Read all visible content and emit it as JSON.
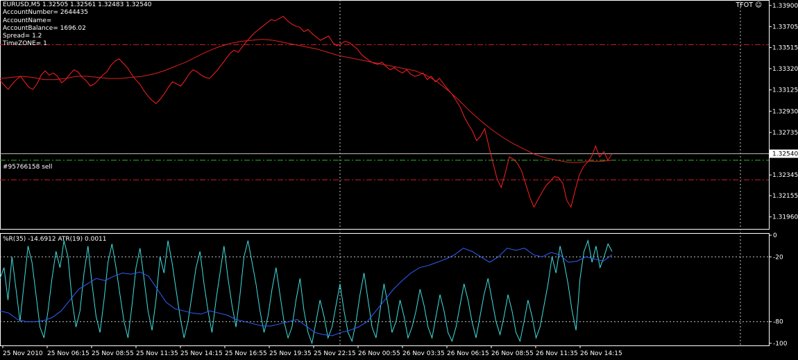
{
  "header": {
    "symbol_line": "EURUSD,M5  1.32505 1.32561 1.32483 1.32540",
    "account_number": "AccountNumber= 2644435",
    "account_name": "AccountName=",
    "account_balance": "AccountBalance= 1696.02",
    "spread": "Spread= 1.2",
    "timezone": "TimeZONE= 1",
    "expert_badge": "TFOT ☺"
  },
  "indicator_label": "%R(35) -14.6912  ATR(19) 0.0011",
  "order_label": "#95766158 sell",
  "colors": {
    "background": "#000000",
    "price_line": "#ff2020",
    "ma_line": "#e02020",
    "wpr_line": "#40e0e0",
    "atr_line": "#3060ff",
    "grid": "#c8c8c8",
    "order_line": "#c0c0c0",
    "stop_line": "#d02020",
    "tp_line": "#20c020"
  },
  "chart_data": [
    {
      "type": "line",
      "panel": "price",
      "ylim": [
        1.3185,
        1.3395
      ],
      "yticks": [
        "1.33900",
        "1.33705",
        "1.33515",
        "1.33320",
        "1.33125",
        "1.32930",
        "1.32735",
        "1.32540",
        "1.32345",
        "1.32155",
        "1.31960"
      ],
      "current_price": "1.32540",
      "order_level": 1.3254,
      "tp_level": 1.3248,
      "stop_levels": [
        1.3354,
        1.323
      ],
      "series": [
        {
          "role": "price",
          "values": [
            1.3321,
            1.3317,
            1.3313,
            1.3318,
            1.3322,
            1.3325,
            1.332,
            1.3315,
            1.3313,
            1.3318,
            1.3326,
            1.333,
            1.3326,
            1.3328,
            1.3325,
            1.3319,
            1.3322,
            1.3327,
            1.3331,
            1.3329,
            1.3324,
            1.3321,
            1.3316,
            1.3318,
            1.3322,
            1.3326,
            1.3329,
            1.3335,
            1.3339,
            1.3341,
            1.3337,
            1.3333,
            1.3327,
            1.3322,
            1.3318,
            1.3312,
            1.3307,
            1.3303,
            1.33,
            1.3304,
            1.3309,
            1.3315,
            1.332,
            1.3318,
            1.3316,
            1.3321,
            1.3327,
            1.3331,
            1.3329,
            1.3326,
            1.3324,
            1.3323,
            1.3327,
            1.3331,
            1.3336,
            1.3341,
            1.3346,
            1.3349,
            1.3347,
            1.3352,
            1.3357,
            1.3361,
            1.3365,
            1.3368,
            1.3371,
            1.3374,
            1.3377,
            1.3376,
            1.3378,
            1.338,
            1.3376,
            1.3373,
            1.3371,
            1.337,
            1.3366,
            1.3368,
            1.3364,
            1.3361,
            1.3358,
            1.336,
            1.3362,
            1.3356,
            1.3353,
            1.3355,
            1.3357,
            1.3356,
            1.3353,
            1.335,
            1.3345,
            1.3342,
            1.3339,
            1.3337,
            1.3336,
            1.3338,
            1.3334,
            1.3331,
            1.3333,
            1.333,
            1.3328,
            1.3331,
            1.3327,
            1.3325,
            1.3326,
            1.3328,
            1.3322,
            1.3325,
            1.332,
            1.3323,
            1.3318,
            1.3313,
            1.3309,
            1.3303,
            1.3297,
            1.3288,
            1.3281,
            1.3275,
            1.3266,
            1.327,
            1.3277,
            1.3261,
            1.3246,
            1.3231,
            1.3223,
            1.3236,
            1.3251,
            1.3249,
            1.3245,
            1.3238,
            1.3226,
            1.3214,
            1.3205,
            1.3212,
            1.3219,
            1.3225,
            1.3229,
            1.3233,
            1.3232,
            1.3227,
            1.3211,
            1.3205,
            1.322,
            1.3234,
            1.3242,
            1.3246,
            1.3251,
            1.3261,
            1.3251,
            1.3256,
            1.3248,
            1.3254
          ]
        },
        {
          "role": "moving-average",
          "values": [
            1.3323,
            1.3324,
            1.3325,
            1.3324,
            1.3322,
            1.3322,
            1.3323,
            1.3325,
            1.3325,
            1.3324,
            1.3323,
            1.3323,
            1.3324,
            1.3325,
            1.3327,
            1.333,
            1.3334,
            1.3338,
            1.3343,
            1.3348,
            1.3352,
            1.3355,
            1.3357,
            1.3358,
            1.3359,
            1.3358,
            1.3356,
            1.3354,
            1.3352,
            1.335,
            1.3347,
            1.3344,
            1.3342,
            1.334,
            1.3338,
            1.3336,
            1.3334,
            1.3332,
            1.333,
            1.3326,
            1.332,
            1.3312,
            1.3303,
            1.3293,
            1.3284,
            1.3276,
            1.3269,
            1.3263,
            1.3258,
            1.3253,
            1.325,
            1.3248,
            1.3246,
            1.3246,
            1.3247,
            1.3247,
            1.3248
          ]
        }
      ]
    },
    {
      "type": "line",
      "panel": "indicator",
      "ylim": [
        -102,
        2
      ],
      "yticks": [
        "0",
        "-20",
        "-80",
        "-100"
      ],
      "levels": [
        -20,
        -80
      ],
      "series": [
        {
          "role": "wpr",
          "values": [
            -40,
            -30,
            -60,
            -20,
            -50,
            -80,
            -45,
            -10,
            -25,
            -55,
            -85,
            -95,
            -70,
            -40,
            -15,
            -30,
            -5,
            -20,
            -60,
            -85,
            -70,
            -35,
            -10,
            -45,
            -75,
            -90,
            -60,
            -25,
            -8,
            -30,
            -55,
            -80,
            -95,
            -65,
            -30,
            -12,
            -40,
            -70,
            -88,
            -60,
            -20,
            -35,
            -5,
            -25,
            -50,
            -75,
            -95,
            -80,
            -55,
            -30,
            -15,
            -45,
            -70,
            -90,
            -60,
            -35,
            -10,
            -40,
            -65,
            -85,
            -55,
            -20,
            -5,
            -25,
            -45,
            -70,
            -90,
            -75,
            -50,
            -30,
            -55,
            -80,
            -95,
            -85,
            -60,
            -40,
            -70,
            -90,
            -100,
            -80,
            -60,
            -75,
            -95,
            -85,
            -65,
            -45,
            -70,
            -90,
            -98,
            -80,
            -55,
            -35,
            -60,
            -85,
            -95,
            -70,
            -45,
            -65,
            -90,
            -80,
            -60,
            -75,
            -95,
            -85,
            -70,
            -50,
            -65,
            -85,
            -95,
            -75,
            -55,
            -70,
            -90,
            -98,
            -85,
            -65,
            -45,
            -60,
            -80,
            -95,
            -75,
            -55,
            -40,
            -60,
            -80,
            -92,
            -75,
            -55,
            -70,
            -90,
            -98,
            -80,
            -60,
            -75,
            -95,
            -85,
            -65,
            -45,
            -20,
            -35,
            -10,
            -25,
            -45,
            -70,
            -88,
            -40,
            -15,
            -5,
            -25,
            -10,
            -30,
            -20,
            -8,
            -15
          ]
        },
        {
          "role": "atr",
          "values": [
            -70,
            -72,
            -78,
            -80,
            -80,
            -79,
            -76,
            -70,
            -60,
            -50,
            -45,
            -40,
            -42,
            -38,
            -35,
            -36,
            -34,
            -38,
            -50,
            -62,
            -68,
            -70,
            -72,
            -73,
            -70,
            -72,
            -74,
            -78,
            -80,
            -82,
            -84,
            -84,
            -82,
            -80,
            -78,
            -84,
            -90,
            -92,
            -93,
            -90,
            -88,
            -85,
            -80,
            -70,
            -60,
            -50,
            -42,
            -35,
            -30,
            -28,
            -25,
            -22,
            -18,
            -12,
            -15,
            -20,
            -25,
            -20,
            -12,
            -14,
            -12,
            -18,
            -20,
            -16,
            -18,
            -25,
            -24,
            -20,
            -22,
            -24,
            -18
          ]
        }
      ]
    }
  ],
  "time_axis": [
    "25 Nov 2010",
    "25 Nov 06:15",
    "25 Nov 08:55",
    "25 Nov 11:35",
    "25 Nov 14:15",
    "25 Nov 16:55",
    "25 Nov 19:35",
    "25 Nov 22:15",
    "26 Nov 00:55",
    "26 Nov 03:35",
    "26 Nov 06:15",
    "26 Nov 08:55",
    "26 Nov 11:35",
    "26 Nov 14:15"
  ]
}
